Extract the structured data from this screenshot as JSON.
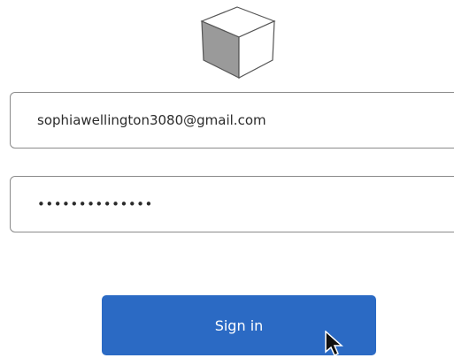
{
  "login": {
    "logo_icon": "cube-icon",
    "email_value": "sophiawellington3080@gmail.com",
    "password_value": "••••••••••••••",
    "signin_label": "Sign in"
  },
  "colors": {
    "button_bg": "#2b6ac4",
    "button_text": "#ffffff",
    "field_border": "#8a8a8a"
  }
}
